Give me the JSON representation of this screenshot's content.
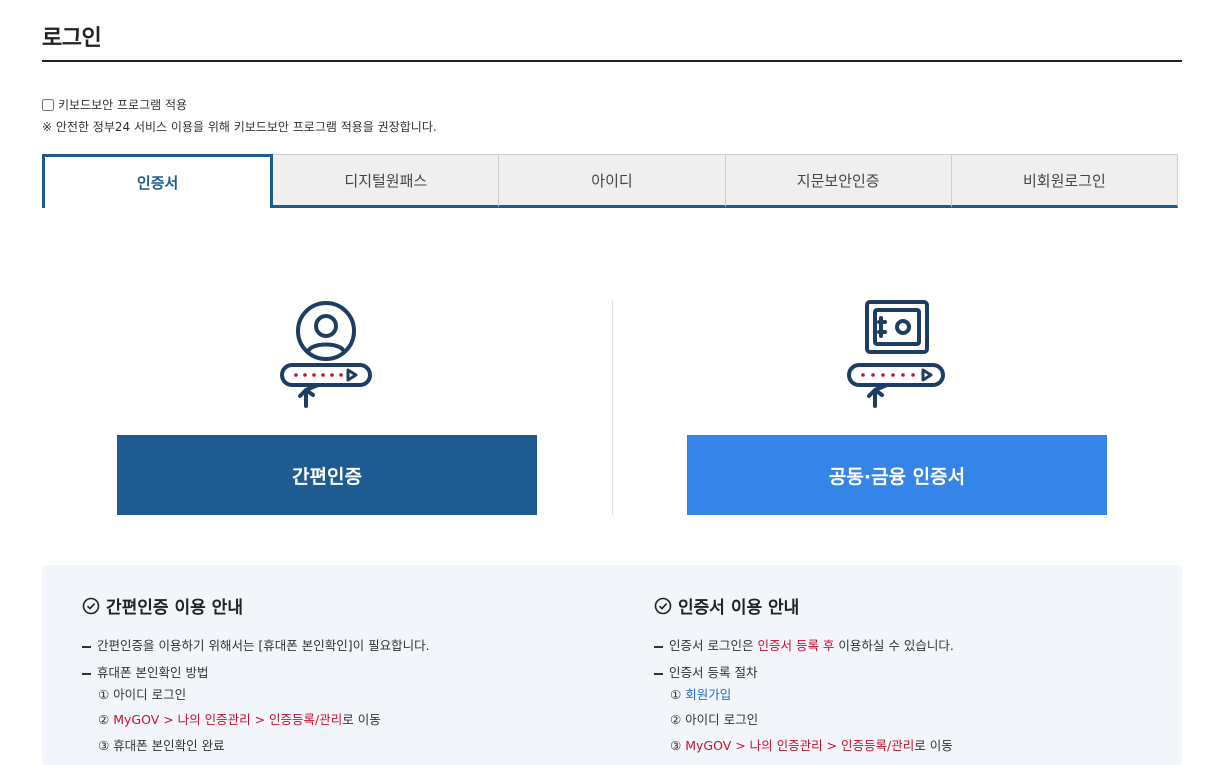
{
  "header": {
    "title": "로그인"
  },
  "keyboard_security": {
    "checkbox_label": "키보드보안 프로그램 적용",
    "checked": false,
    "note": "※ 안전한 정부24 서비스 이용을 위해 키보드보안 프로그램 적용을 권장합니다."
  },
  "tabs": [
    {
      "label": "인증서",
      "active": true
    },
    {
      "label": "디지털원패스",
      "active": false
    },
    {
      "label": "아이디",
      "active": false
    },
    {
      "label": "지문보안인증",
      "active": false
    },
    {
      "label": "비회원로그인",
      "active": false
    }
  ],
  "login_options": {
    "simple_auth_button": "간편인증",
    "certificate_button": "공동·금융 인증서"
  },
  "colors": {
    "primary": "#1e5b91",
    "secondary": "#3584e8",
    "highlight": "#c8102e",
    "guide_bg": "#f2f5f9"
  },
  "icons": [
    "user-password-icon",
    "safe-password-icon",
    "check-circle-icon"
  ],
  "guide_left": {
    "title": "간편인증 이용 안내",
    "line1_pre": "간편인증을 이용하기 위해서는 [휴대폰 본인확인]이 필요합니다.",
    "line2": "휴대폰 본인확인 방법",
    "step1": "① 아이디 로그인",
    "step2_num": "②",
    "step2_path": "MyGOV > 나의 인증관리 > 인증등록/관리",
    "step2_suffix": "로 이동",
    "step3": "③ 휴대폰 본인확인 완료"
  },
  "guide_right": {
    "title": "인증서 이용 안내",
    "line1_pre": "인증서 로그인은",
    "line1_highlight": "인증서 등록 후",
    "line1_post": "이용하실 수 있습니다.",
    "line2": "인증서 등록 절차",
    "step1_num": "①",
    "step1_link": "회원가입",
    "step2": "② 아이디 로그인",
    "step3_num": "③",
    "step3_path": "MyGOV > 나의 인증관리 > 인증등록/관리",
    "step3_suffix": "로 이동"
  }
}
